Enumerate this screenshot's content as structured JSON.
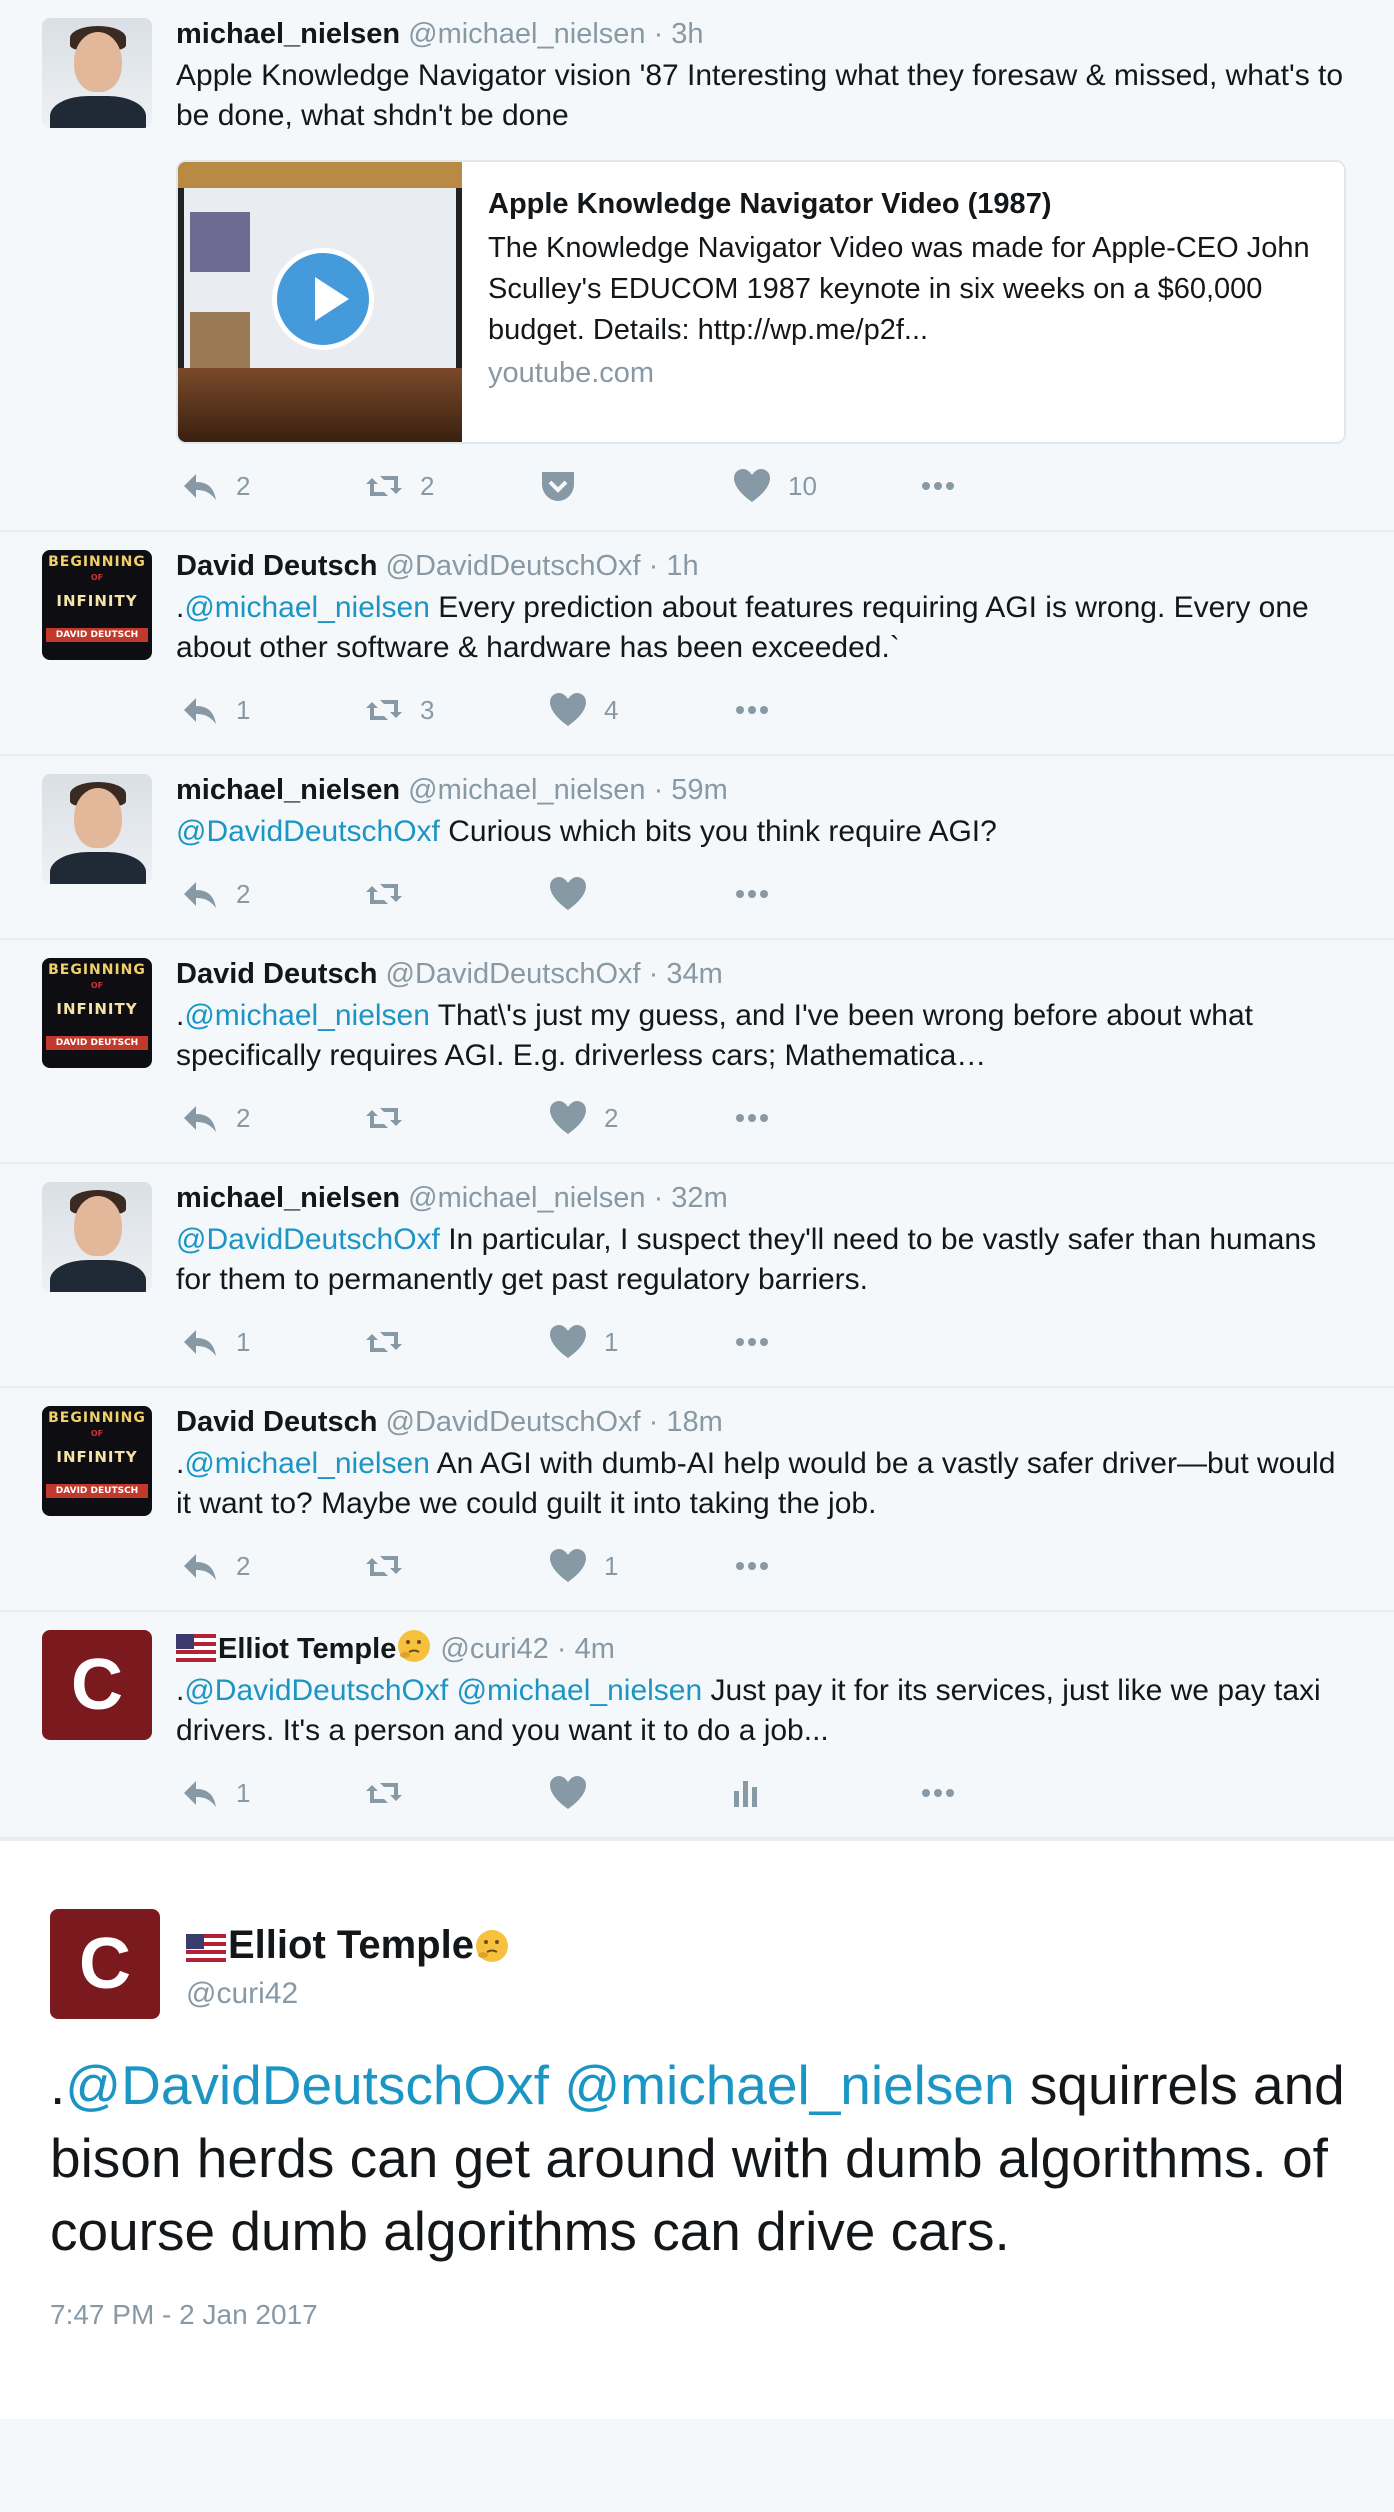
{
  "tweets": [
    {
      "avatar": "michael-nielsen-photo",
      "name": "michael_nielsen",
      "handle": "@michael_nielsen",
      "time": "· 3h",
      "segments": [
        {
          "t": "Apple Knowledge Navigator vision '87 Interesting what they foresaw & missed, what's to be done, what shdn't be done",
          "m": false
        }
      ],
      "card": {
        "title": "Apple Knowledge Navigator Video (1987)",
        "desc": "The Knowledge Navigator Video was made for Apple-CEO John Sculley's EDUCOM 1987 keynote in six weeks on a $60,000 budget. Details: http://wp.me/p2f...",
        "domain": "youtube.com"
      },
      "reply": "2",
      "retweet": "2",
      "like": "10",
      "pocket": true,
      "analytics": false
    },
    {
      "avatar": "beginning-of-infinity-cover",
      "name": "David Deutsch",
      "handle": "@DavidDeutschOxf",
      "time": "· 1h",
      "segments": [
        {
          "t": ".",
          "m": false
        },
        {
          "t": "@michael_nielsen",
          "m": true
        },
        {
          "t": " Every prediction about features requiring AGI is wrong. Every one about other software & hardware has been exceeded.`",
          "m": false
        }
      ],
      "reply": "1",
      "retweet": "3",
      "like": "4",
      "pocket": false,
      "analytics": false
    },
    {
      "avatar": "michael-nielsen-photo",
      "name": "michael_nielsen",
      "handle": "@michael_nielsen",
      "time": "· 59m",
      "segments": [
        {
          "t": "@DavidDeutschOxf",
          "m": true
        },
        {
          "t": " Curious which bits you think require AGI?",
          "m": false
        }
      ],
      "reply": "2",
      "retweet": "",
      "like": "",
      "pocket": false,
      "analytics": false
    },
    {
      "avatar": "beginning-of-infinity-cover",
      "name": "David Deutsch",
      "handle": "@DavidDeutschOxf",
      "time": "· 34m",
      "segments": [
        {
          "t": ".",
          "m": false
        },
        {
          "t": "@michael_nielsen",
          "m": true
        },
        {
          "t": " That\\'s just my guess, and I've been wrong before about what specifically requires AGI. E.g. driverless cars; Mathematica…",
          "m": false
        }
      ],
      "reply": "2",
      "retweet": "",
      "like": "2",
      "pocket": false,
      "analytics": false
    },
    {
      "avatar": "michael-nielsen-photo",
      "name": "michael_nielsen",
      "handle": "@michael_nielsen",
      "time": "· 32m",
      "segments": [
        {
          "t": "@DavidDeutschOxf",
          "m": true
        },
        {
          "t": " In particular, I suspect they'll need to be vastly safer than humans for them to permanently get past regulatory barriers.",
          "m": false
        }
      ],
      "reply": "1",
      "retweet": "",
      "like": "1",
      "pocket": false,
      "analytics": false
    },
    {
      "avatar": "beginning-of-infinity-cover",
      "name": "David Deutsch",
      "handle": "@DavidDeutschOxf",
      "time": "· 18m",
      "segments": [
        {
          "t": ".",
          "m": false
        },
        {
          "t": "@michael_nielsen",
          "m": true
        },
        {
          "t": " An AGI with dumb-AI help would be a vastly safer driver—but would it want to? Maybe we could guilt it into taking the job.",
          "m": false
        }
      ],
      "reply": "2",
      "retweet": "",
      "like": "1",
      "pocket": false,
      "analytics": false
    },
    {
      "avatar": "elliot-c-logo",
      "name": "Elliot Temple",
      "flag": true,
      "emoji": true,
      "handle": "@curi42",
      "time": "· 4m",
      "segments": [
        {
          "t": ".",
          "m": false
        },
        {
          "t": "@DavidDeutschOxf",
          "m": true
        },
        {
          "t": " ",
          "m": false
        },
        {
          "t": "@michael_nielsen",
          "m": true
        },
        {
          "t": " Just pay it for its services, just like we pay taxi drivers. It's a person and you want it to do a job...",
          "m": false
        }
      ],
      "reply": "1",
      "retweet": "",
      "like": "",
      "pocket": false,
      "analytics": true
    }
  ],
  "main": {
    "avatar_letter": "C",
    "name": "Elliot Temple",
    "handle": "@curi42",
    "segments": [
      {
        "t": ".",
        "m": false
      },
      {
        "t": "@DavidDeutschOxf",
        "m": true
      },
      {
        "t": " ",
        "m": false
      },
      {
        "t": "@michael_nielsen",
        "m": true
      },
      {
        "t": " squirrels and bison herds can get around with dumb algorithms. of course dumb algorithms can drive cars.",
        "m": false
      }
    ],
    "time": "7:47 PM - 2 Jan 2017"
  },
  "book_cover": {
    "line1": "BEGINNING",
    "line2": "OF",
    "line3": "INFINITY",
    "line4": "DAVID DEUTSCH"
  },
  "colors": {
    "background": "#f5f8fa",
    "mention": "#1b95c4",
    "meta": "#8899a6",
    "divider": "#e6ecf0",
    "avatar_c": "#7b1a1e"
  },
  "icons": [
    "reply-icon",
    "retweet-icon",
    "like-icon",
    "pocket-icon",
    "analytics-icon",
    "more-icon",
    "play-icon",
    "us-flag-icon",
    "thinking-face-icon"
  ]
}
